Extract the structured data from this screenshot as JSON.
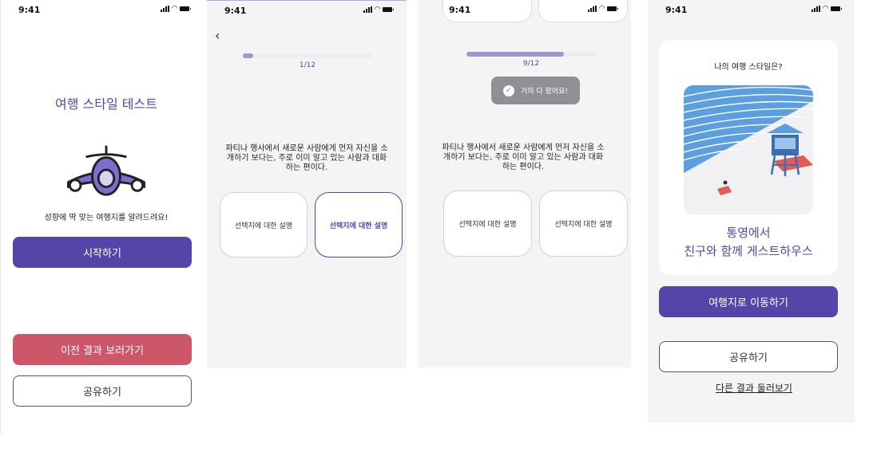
{
  "status_bar": {
    "time": "9:41"
  },
  "screen1": {
    "title": "여행 스타일 테스트",
    "subtitle": "성향에 딱 맞는 여행지를 알려드려요!",
    "start_button": "시작하기",
    "previous_result_button": "이전 결과 보러가기",
    "share_button": "공유하기"
  },
  "screen2": {
    "progress_label": "1/12",
    "progress_fraction": 0.083,
    "question": [
      "파티나 행사에서 새로운 사람에게 먼저 자신을 소",
      "개하기 보다는, 주로 이미 알고 있는 사람과 대화",
      "하는 편이다."
    ],
    "choice_left": "선택지에 대한 설명",
    "choice_right": "선택지에 대한 설명"
  },
  "screen3": {
    "progress_label": "9/12",
    "progress_fraction": 0.75,
    "toast": "거의 다 왔어요!",
    "question": [
      "파티나 행사에서 새로운 사람에게 먼저 자신을 소",
      "개하기 보다는, 주로 이미 알고 있는 사람과 대화",
      "하는 편이다."
    ],
    "choice_left": "선택지에 대한 설명",
    "choice_right": "선택지에 대한 설명"
  },
  "screen4": {
    "card_title": "나의 여행 스타일은?",
    "result_line1": "통영에서",
    "result_line2": "친구와 함께 게스트하우스",
    "go_button": "여행지로 이동하기",
    "share_button": "공유하기",
    "other_results_link": "다른 결과 둘러보기"
  },
  "colors": {
    "primary": "#5545a8",
    "red": "#cb5768",
    "progress": "#9e97d2",
    "toast": "#8f8f96"
  }
}
